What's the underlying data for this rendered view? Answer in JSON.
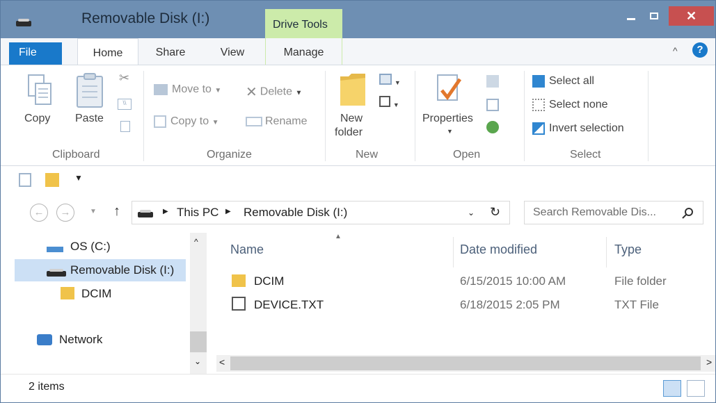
{
  "window": {
    "title": "Removable Disk (I:)",
    "context_tab": "Drive Tools",
    "close_glyph": "✕"
  },
  "tabs": {
    "file": "File",
    "home": "Home",
    "share": "Share",
    "view": "View",
    "manage": "Manage",
    "help": "?"
  },
  "ribbon": {
    "clipboard": {
      "copy": "Copy",
      "paste": "Paste",
      "label": "Clipboard"
    },
    "organize": {
      "move_to": "Move to",
      "copy_to": "Copy to",
      "delete": "Delete",
      "rename": "Rename",
      "label": "Organize"
    },
    "new": {
      "new_folder_line1": "New",
      "new_folder_line2": "folder",
      "label": "New"
    },
    "open": {
      "properties": "Properties",
      "label": "Open"
    },
    "select": {
      "select_all": "Select all",
      "select_none": "Select none",
      "invert_selection": "Invert selection",
      "label": "Select"
    }
  },
  "address": {
    "crumb_pc": "This PC",
    "crumb_drive": "Removable Disk (I:)",
    "search_placeholder": "Search Removable Dis..."
  },
  "nav_pane": {
    "items": [
      {
        "label": "OS (C:)",
        "icon": "windows-drive-icon"
      },
      {
        "label": "Removable Disk (I:)",
        "icon": "removable-drive-icon",
        "selected": true
      },
      {
        "label": "DCIM",
        "icon": "folder-icon"
      },
      {
        "label": "Network",
        "icon": "network-icon"
      }
    ]
  },
  "file_list": {
    "columns": {
      "name": "Name",
      "date": "Date modified",
      "type": "Type"
    },
    "rows": [
      {
        "name": "DCIM",
        "date": "6/15/2015 10:00 AM",
        "type": "File folder",
        "icon": "folder-icon"
      },
      {
        "name": "DEVICE.TXT",
        "date": "6/18/2015 2:05 PM",
        "type": "TXT File",
        "icon": "text-file-icon"
      }
    ]
  },
  "status": {
    "item_count": "2 items"
  },
  "colors": {
    "titlebar": "#6e8fb3",
    "drive_tools": "#ccebaa",
    "file_tab": "#1979ca",
    "close": "#c75050"
  }
}
